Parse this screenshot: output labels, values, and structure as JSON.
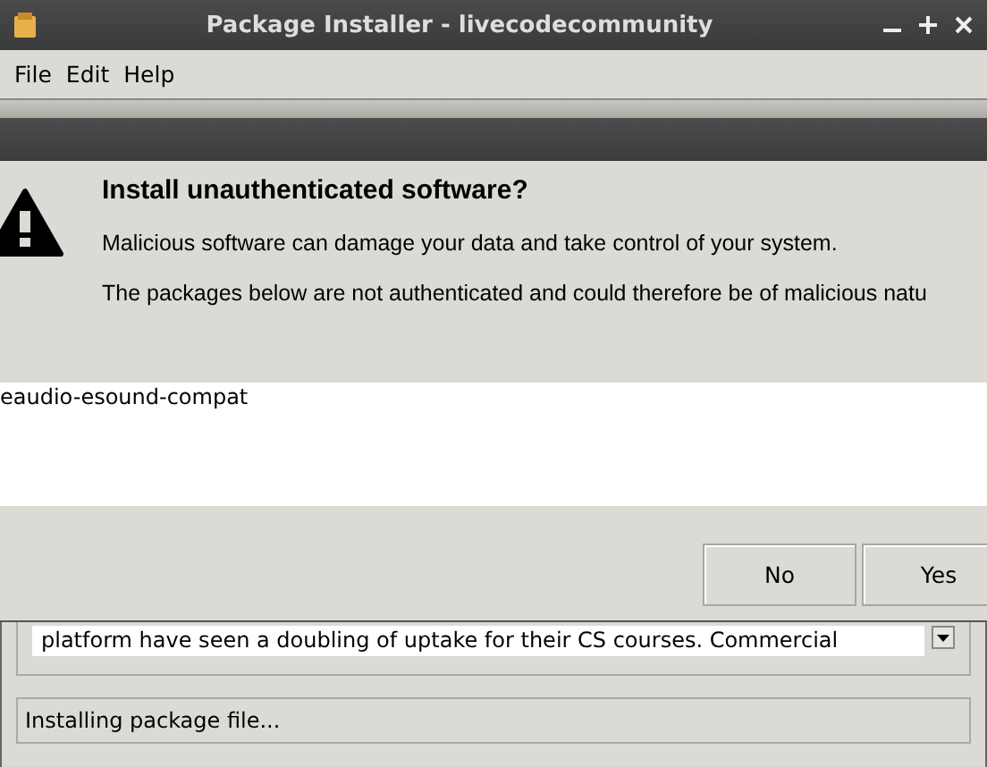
{
  "window": {
    "title": "Package Installer - livecodecommunity"
  },
  "menu": [
    "File",
    "Edit",
    "Help"
  ],
  "dialog": {
    "heading": "Install unauthenticated software?",
    "message": "Malicious software can damage your data and take control of your system.",
    "detail": "The packages below are not authenticated and could therefore be of malicious natu",
    "packages": [
      "eaudio-esound-compat"
    ],
    "buttons": [
      "No",
      "Yes"
    ]
  },
  "description": {
    "text": "platform have seen a doubling of uptake for their CS courses. Commercial"
  },
  "status_bar": {
    "text": "Installing package file..."
  }
}
